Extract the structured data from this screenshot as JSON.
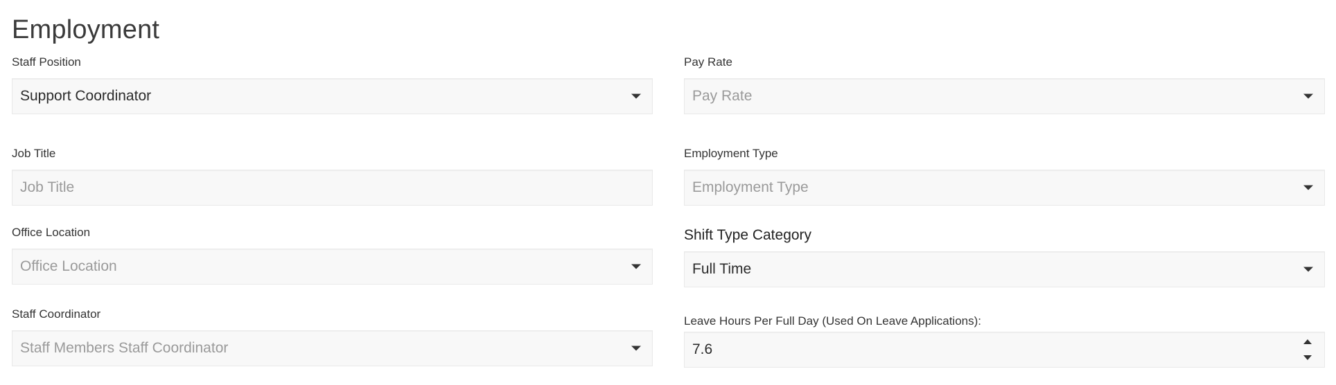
{
  "section": {
    "title": "Employment"
  },
  "fields": {
    "staff_position": {
      "label": "Staff Position",
      "value": "Support Coordinator"
    },
    "job_title": {
      "label": "Job Title",
      "placeholder": "Job Title"
    },
    "office_location": {
      "label": "Office Location",
      "placeholder": "Office Location"
    },
    "staff_coordinator": {
      "label": "Staff Coordinator",
      "placeholder": "Staff Members Staff Coordinator"
    },
    "pay_rate": {
      "label": "Pay Rate",
      "placeholder": "Pay Rate"
    },
    "employment_type": {
      "label": "Employment Type",
      "placeholder": "Employment Type"
    },
    "shift_type_category": {
      "label": "Shift Type Category",
      "value": "Full Time"
    },
    "leave_hours": {
      "label": "Leave Hours Per Full Day (Used On Leave Applications):",
      "value": "7.6"
    }
  },
  "icons": {
    "dropdown": "chevron-down-icon",
    "spinner_up": "spinner-up-icon",
    "spinner_down": "spinner-down-icon"
  }
}
